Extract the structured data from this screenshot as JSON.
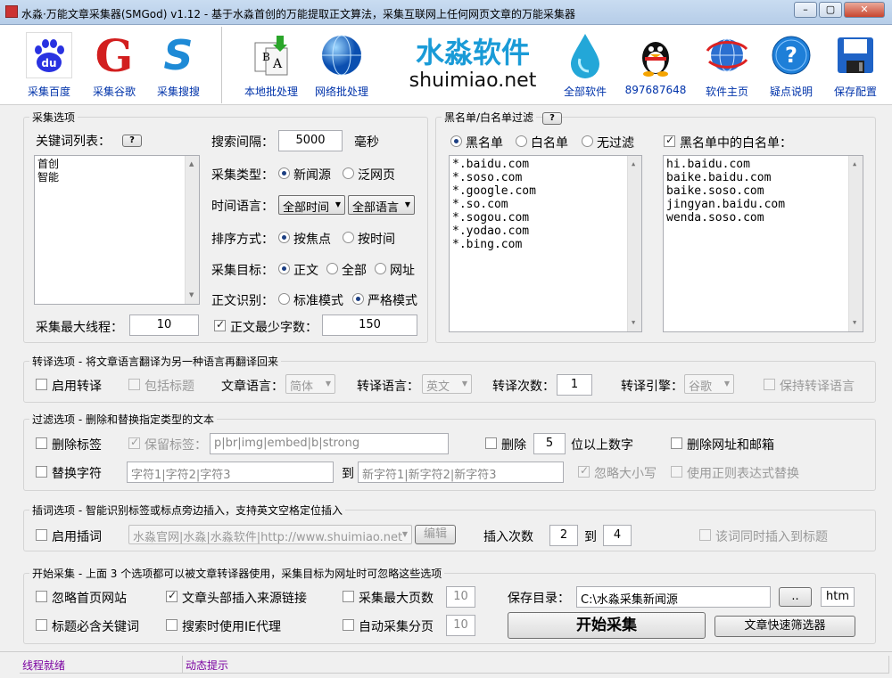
{
  "window": {
    "title": "水淼·万能文章采集器(SMGod) v1.12 - 基于水淼首创的万能提取正文算法，采集互联网上任何网页文章的万能采集器",
    "min": "–",
    "max": "▢",
    "close": "✕"
  },
  "toolbar": {
    "baidu": "采集百度",
    "google": "采集谷歌",
    "sogou": "采集搜搜",
    "local_batch": "本地批处理",
    "net_batch": "网络批处理",
    "brand_cn": "水淼软件",
    "brand_en": "shuimiao.net",
    "all_software": "全部软件",
    "qq": "897687648",
    "homepage": "软件主页",
    "faq": "疑点说明",
    "save_config": "保存配置",
    "google_letter": "G",
    "sogou_letter": "S",
    "baidu_text": "du"
  },
  "collect": {
    "legend": "采集选项",
    "keyword_label": "关键词列表：",
    "help": "?",
    "keywords": [
      "首创",
      "智能"
    ],
    "max_threads_label": "采集最大线程：",
    "max_threads": "10",
    "interval_label": "搜索间隔：",
    "interval": "5000",
    "interval_unit": "毫秒",
    "type_label": "采集类型：",
    "type_news": "新闻源",
    "type_web": "泛网页",
    "timelang_label": "时间语言：",
    "time_value": "全部时间",
    "lang_value": "全部语言",
    "sort_label": "排序方式：",
    "sort_focus": "按焦点",
    "sort_time": "按时间",
    "target_label": "采集目标：",
    "target_body": "正文",
    "target_all": "全部",
    "target_url": "网址",
    "detect_label": "正文识别：",
    "mode_std": "标准模式",
    "mode_strict": "严格模式",
    "min_chars_label": "正文最少字数：",
    "min_chars": "150"
  },
  "filter_lists": {
    "legend": "黑名单/白名单过滤",
    "help": "?",
    "blacklist": "黑名单",
    "whitelist": "白名单",
    "nofilter": "无过滤",
    "white_in_black": "黑名单中的白名单：",
    "black_items": [
      "*.baidu.com",
      "*.soso.com",
      "*.google.com",
      "*.so.com",
      "*.sogou.com",
      "*.yodao.com",
      "*.bing.com"
    ],
    "white_items": [
      "hi.baidu.com",
      "baike.baidu.com",
      "baike.soso.com",
      "jingyan.baidu.com",
      "wenda.soso.com"
    ]
  },
  "translate": {
    "legend": "转译选项 - 将文章语言翻译为另一种语言再翻译回来",
    "enable": "启用转译",
    "include_title": "包括标题",
    "article_lang_label": "文章语言：",
    "article_lang": "简体",
    "target_lang_label": "转译语言：",
    "target_lang": "英文",
    "times_label": "转译次数：",
    "times": "1",
    "engine_label": "转译引擎：",
    "engine": "谷歌",
    "keep_lang": "保持转译语言"
  },
  "filtering": {
    "legend": "过滤选项 - 删除和替换指定类型的文本",
    "remove_tags": "删除标签",
    "keep_tags": "保留标签：",
    "keep_tags_value": "p|br|img|embed|b|strong",
    "delete_label": "删除",
    "delete_digits": "5",
    "digits_suffix": "位以上数字",
    "remove_urls": "删除网址和邮箱",
    "replace_chars": "替换字符",
    "replace_from": "字符1|字符2|字符3",
    "to_label": "到",
    "replace_to": "新字符1|新字符2|新字符3",
    "ignore_case": "忽略大小写",
    "use_regex": "使用正则表达式替换"
  },
  "insert": {
    "legend": "插词选项 - 智能识别标签或标点旁边插入，支持英文空格定位插入",
    "enable": "启用插词",
    "words": "水淼官网|水淼|水淼软件|http://www.shuimiao.net",
    "edit": "编辑",
    "times_label": "插入次数",
    "from": "2",
    "to_label": "到",
    "to": "4",
    "also_title": "该词同时插入到标题"
  },
  "start": {
    "legend": "开始采集 - 上面 3 个选项都可以被文章转译器使用，采集目标为网址时可忽略这些选项",
    "ignore_home": "忽略首页网站",
    "insert_source": "文章头部插入来源链接",
    "max_pages": "采集最大页数",
    "max_pages_value": "10",
    "title_kw": "标题必含关键词",
    "ie_proxy": "搜索时使用IE代理",
    "auto_pages": "自动采集分页",
    "auto_pages_value": "10",
    "save_dir_label": "保存目录：",
    "save_dir": "C:\\水淼采集新闻源",
    "browse": "..",
    "ext": "htm",
    "start_button": "开始采集",
    "filter_button": "文章快速筛选器"
  },
  "status": {
    "left": "线程就绪",
    "right": "动态提示"
  },
  "colors": {
    "accent": "#0033aa",
    "status_text": "#7a00a0"
  }
}
